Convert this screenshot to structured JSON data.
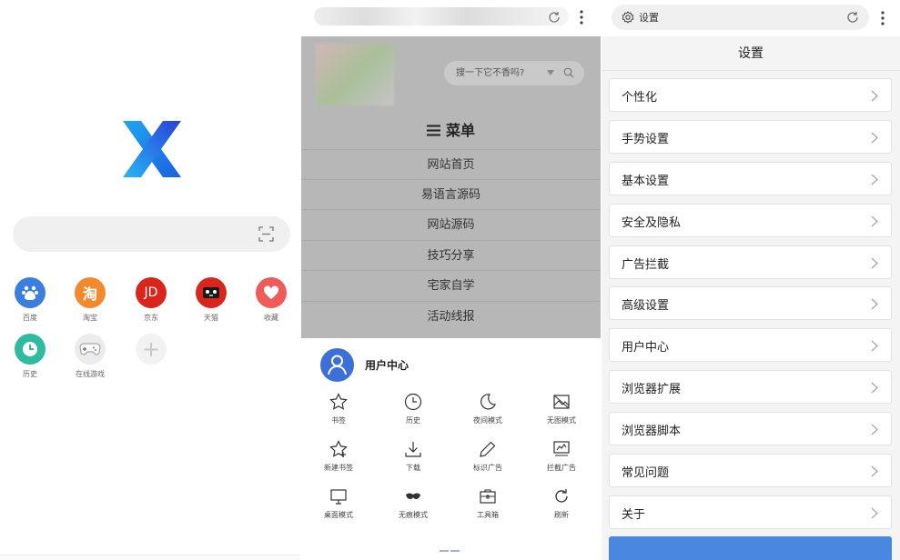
{
  "home": {
    "shortcuts": [
      {
        "label": "百度",
        "glyph": "du",
        "color": "#3b7ee0"
      },
      {
        "label": "淘宝",
        "glyph": "淘",
        "color": "#f28a2d"
      },
      {
        "label": "京东",
        "glyph": "JD",
        "color": "#d9261c"
      },
      {
        "label": "天猫",
        "glyph": "",
        "color": "#d9261c"
      },
      {
        "label": "收藏",
        "glyph": "",
        "color": "#ef5b5b"
      },
      {
        "label": "历史",
        "glyph": "",
        "color": "#2fbba0"
      },
      {
        "label": "在线游戏",
        "glyph": "",
        "color": "#e9e9e9"
      },
      {
        "label": "",
        "glyph": "+",
        "color": "#f0f0f0"
      }
    ],
    "icons": {
      "logo": "x-logo",
      "scan": "scan-icon"
    }
  },
  "menu_panel": {
    "site_search_placeholder": "搜一下它不香吗?",
    "menu_title": "菜单",
    "menu_items": [
      "网站首页",
      "易语言源码",
      "网站源码",
      "技巧分享",
      "宅家自学",
      "活动线报"
    ],
    "user_center": "用户中心",
    "tools": [
      {
        "label": "书签",
        "icon": "star-icon"
      },
      {
        "label": "历史",
        "icon": "clock-icon"
      },
      {
        "label": "夜间模式",
        "icon": "moon-icon"
      },
      {
        "label": "无图模式",
        "icon": "no-image-icon"
      },
      {
        "label": "新建书签",
        "icon": "star-plus-icon"
      },
      {
        "label": "下载",
        "icon": "download-icon"
      },
      {
        "label": "标识广告",
        "icon": "pen-icon"
      },
      {
        "label": "拦截广告",
        "icon": "block-ad-icon"
      },
      {
        "label": "桌面模式",
        "icon": "monitor-icon"
      },
      {
        "label": "无痕模式",
        "icon": "mask-icon"
      },
      {
        "label": "工具箱",
        "icon": "toolbox-icon"
      },
      {
        "label": "刷新",
        "icon": "refresh-icon"
      }
    ]
  },
  "settings": {
    "url_text": "设置",
    "page_title": "设置",
    "items": [
      "个性化",
      "手势设置",
      "基本设置",
      "安全及隐私",
      "广告拦截",
      "高级设置",
      "用户中心",
      "浏览器扩展",
      "浏览器脚本",
      "常见问题",
      "关于"
    ]
  },
  "colors": {
    "accent": "#3d6fd9",
    "bottom_button": "#4a87e0",
    "menu_overlay": "#b7b7b7"
  }
}
